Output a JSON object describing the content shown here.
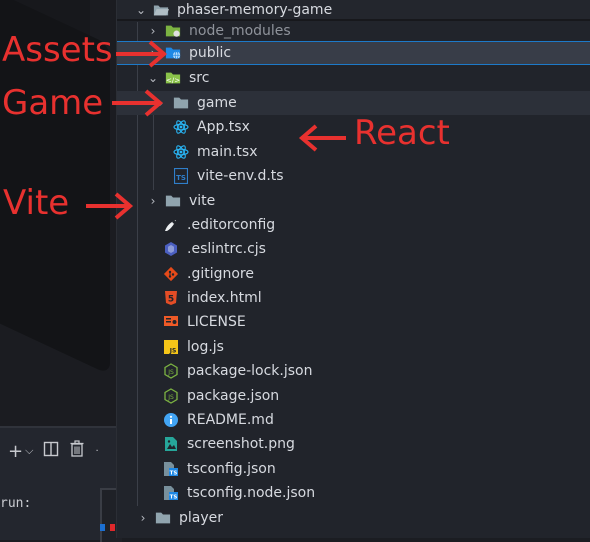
{
  "explorer": {
    "root": {
      "label": "phaser-memory-game",
      "expanded": true
    },
    "items": [
      {
        "label": "node_modules",
        "type": "folder",
        "icon": "node-folder-icon",
        "expanded": false,
        "dimmed": true
      },
      {
        "label": "public",
        "type": "folder",
        "icon": "public-folder-icon",
        "expanded": false,
        "selected": true
      },
      {
        "label": "src",
        "type": "folder",
        "icon": "src-folder-icon",
        "expanded": true
      },
      {
        "label": "game",
        "type": "folder",
        "icon": "folder-icon",
        "expanded": false,
        "hover": true
      },
      {
        "label": "App.tsx",
        "type": "file",
        "icon": "react-icon"
      },
      {
        "label": "main.tsx",
        "type": "file",
        "icon": "react-icon"
      },
      {
        "label": "vite-env.d.ts",
        "type": "file",
        "icon": "typescript-icon"
      },
      {
        "label": "vite",
        "type": "folder",
        "icon": "folder-icon",
        "expanded": false
      },
      {
        "label": ".editorconfig",
        "type": "file",
        "icon": "editorconfig-icon"
      },
      {
        "label": ".eslintrc.cjs",
        "type": "file",
        "icon": "eslint-icon"
      },
      {
        "label": ".gitignore",
        "type": "file",
        "icon": "git-icon"
      },
      {
        "label": "index.html",
        "type": "file",
        "icon": "html5-icon"
      },
      {
        "label": "LICENSE",
        "type": "file",
        "icon": "license-icon"
      },
      {
        "label": "log.js",
        "type": "file",
        "icon": "javascript-icon"
      },
      {
        "label": "package-lock.json",
        "type": "file",
        "icon": "nodejs-icon"
      },
      {
        "label": "package.json",
        "type": "file",
        "icon": "nodejs-icon"
      },
      {
        "label": "README.md",
        "type": "file",
        "icon": "info-icon"
      },
      {
        "label": "screenshot.png",
        "type": "file",
        "icon": "image-icon"
      },
      {
        "label": "tsconfig.json",
        "type": "file",
        "icon": "tsconfig-icon"
      },
      {
        "label": "tsconfig.node.json",
        "type": "file",
        "icon": "tsconfig-icon"
      },
      {
        "label": "player",
        "type": "folder",
        "icon": "folder-icon",
        "expanded": false
      }
    ]
  },
  "annotations": {
    "assets": "Assets",
    "game": "Game",
    "vite": "Vite",
    "react": "React"
  },
  "terminal": {
    "text": "run:",
    "tools": [
      "add-icon",
      "chevron-down-icon",
      "split-icon",
      "trash-icon"
    ]
  },
  "colors": {
    "annotation": "#e8312f",
    "selection_border": "#1d7ac9",
    "selected_row": "#383d48",
    "sidebar_bg": "#21242b"
  }
}
